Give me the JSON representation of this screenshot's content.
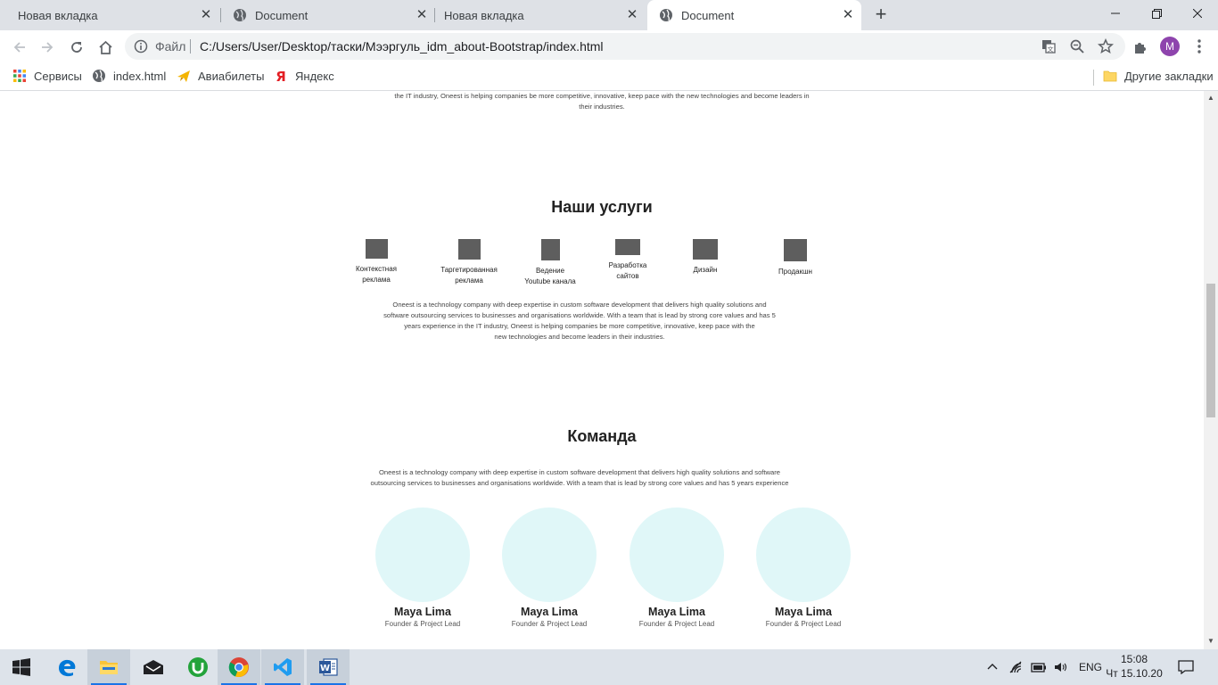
{
  "browser": {
    "tabs": [
      {
        "label": "Новая вкладка",
        "active": false
      },
      {
        "label": "Document",
        "active": false
      },
      {
        "label": "Новая вкладка",
        "active": false
      },
      {
        "label": "Document",
        "active": true
      }
    ],
    "new_tab_icon": "plus-icon",
    "window_controls": [
      "minimize-icon",
      "restore-icon",
      "close-icon"
    ],
    "omnibox": {
      "scheme_label": "Файл",
      "url": "C:/Users/User/Desktop/таски/Мээргуль_idm_about-Bootstrap/index.html"
    },
    "profile_initial": "M",
    "profile_color": "#8e44ad",
    "bookmarks": [
      {
        "label": "Сервисы",
        "icon": "apps-grid-icon"
      },
      {
        "label": "index.html",
        "icon": "globe-icon"
      },
      {
        "label": "Авиабилеты",
        "icon": "airplane-icon"
      },
      {
        "label": "Яндекс",
        "icon": "yandex-icon"
      }
    ],
    "other_bookmarks": "Другие закладки"
  },
  "page": {
    "intro_tail": {
      "line1": "the IT industry, Oneest is helping companies be more competitive, innovative, keep pace with the new technologies and become leaders in",
      "line2": "their industries."
    },
    "services": {
      "title": "Наши услуги",
      "items": [
        {
          "line1": "Контекстная",
          "line2": "реклама"
        },
        {
          "line1": "Таргетированная",
          "line2": "реклама"
        },
        {
          "line1": "Ведение",
          "line2": "Youtube канала"
        },
        {
          "line1": "Разработка",
          "line2": "сайтов"
        },
        {
          "line1": "Дизайн",
          "line2": ""
        },
        {
          "line1": "Продакшн",
          "line2": ""
        }
      ],
      "paragraph": {
        "line1": "Oneest is a technology company with deep expertise in custom software development that delivers high quality solutions and",
        "line2": "software outsourcing services to businesses and organisations worldwide. With a team that is lead by strong core values and has 5",
        "line3": "years experience in the IT industry, Oneest is helping companies be more competitive, innovative, keep pace with the",
        "line4": "new technologies and become leaders in their industries."
      }
    },
    "team": {
      "title": "Команда",
      "paragraph": {
        "line1": "Oneest is a technology company with deep expertise in custom software development that delivers high quality solutions and software",
        "line2": "outsourcing services to businesses and organisations worldwide. With a team that is lead by strong core values and has 5 years experience"
      },
      "members": [
        {
          "name": "Maya Lima",
          "role": "Founder & Project Lead"
        },
        {
          "name": "Maya Lima",
          "role": "Founder & Project Lead"
        },
        {
          "name": "Maya Lima",
          "role": "Founder & Project Lead"
        },
        {
          "name": "Maya Lima",
          "role": "Founder & Project Lead"
        }
      ],
      "circle_color": "#e0f7f8"
    }
  },
  "taskbar": {
    "apps": [
      "windows-start-icon",
      "edge-icon",
      "file-explorer-icon",
      "mail-icon",
      "utorrent-icon",
      "chrome-icon",
      "vscode-icon",
      "word-icon"
    ],
    "language": "ENG",
    "time": "15:08",
    "date": "Чт 15.10.20"
  }
}
